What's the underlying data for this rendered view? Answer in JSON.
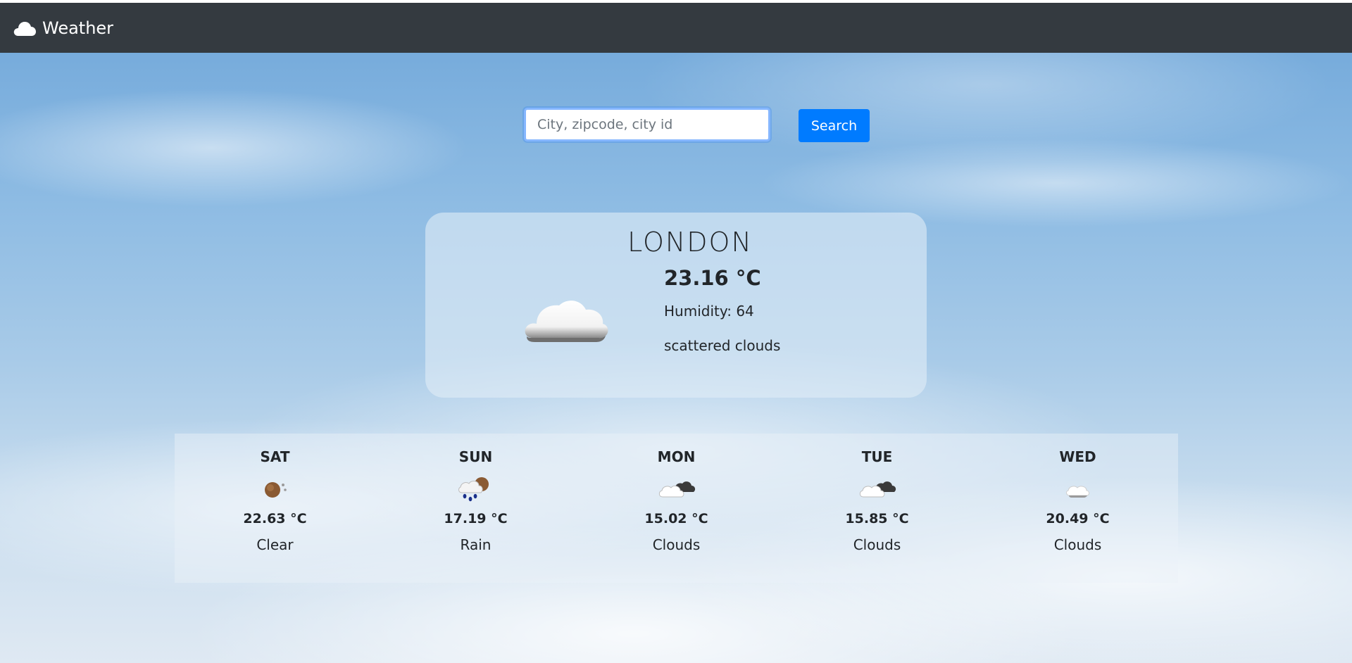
{
  "navbar": {
    "brand_icon": "cloud-icon",
    "brand": "Weather",
    "background": "#343a40"
  },
  "search": {
    "placeholder": "City, zipcode, city id",
    "value": "",
    "button_label": "Search",
    "button_color": "#007bff"
  },
  "current": {
    "city": "LONDON",
    "temperature": "23.16 °C",
    "humidity_label": "Humidity: 64",
    "description": "scattered clouds",
    "icon": "scattered-clouds-icon"
  },
  "forecast": [
    {
      "day": "SAT",
      "temp": "22.63 °C",
      "desc": "Clear",
      "icon": "clear-night-icon"
    },
    {
      "day": "SUN",
      "temp": "17.19 °C",
      "desc": "Rain",
      "icon": "rain-icon"
    },
    {
      "day": "MON",
      "temp": "15.02 °C",
      "desc": "Clouds",
      "icon": "broken-clouds-icon"
    },
    {
      "day": "TUE",
      "temp": "15.85 °C",
      "desc": "Clouds",
      "icon": "broken-clouds-icon"
    },
    {
      "day": "WED",
      "temp": "20.49 °C",
      "desc": "Clouds",
      "icon": "few-clouds-icon"
    }
  ]
}
